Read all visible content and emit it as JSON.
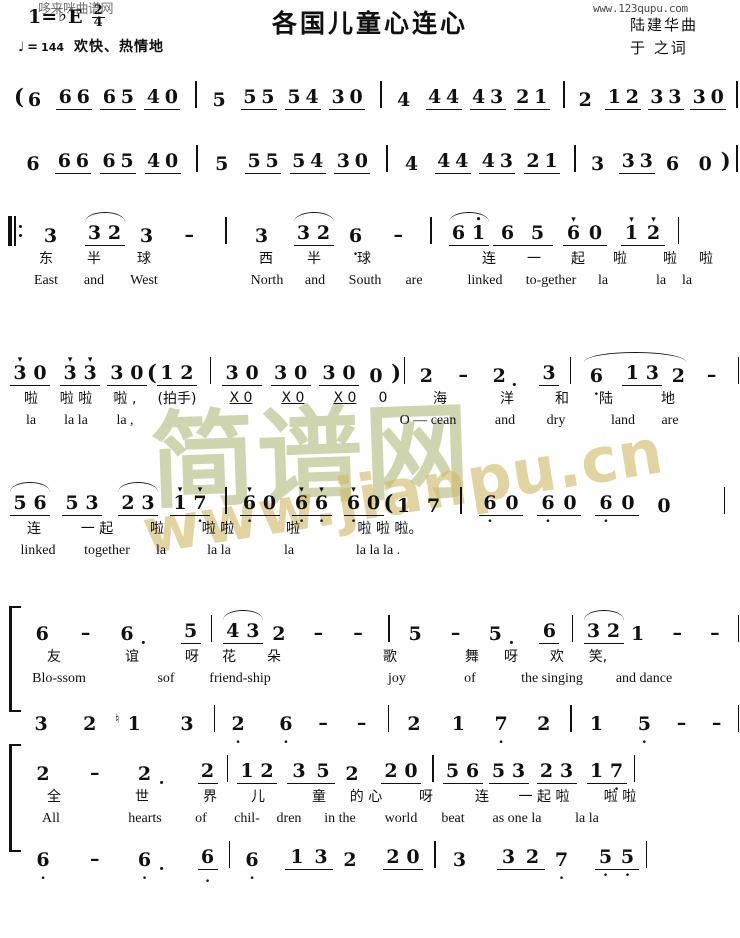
{
  "meta": {
    "title": "各国儿童心连心",
    "composer_credit": "陆建华曲",
    "lyricist_credit": "于 之词",
    "key_label": "1=",
    "key_accidental": "♭",
    "key_letter": "E",
    "time_num": "2",
    "time_den": "4",
    "tempo_note": "♩",
    "tempo_eq": "=",
    "tempo_bpm": "144",
    "expression": "欢快、热情地",
    "watermark_top": "哆来咪曲谱网",
    "watermark_url": "www.123qupu.com",
    "watermark_big": "简谱网",
    "watermark_sub": "www.jianpu.cn"
  },
  "systems": [
    {
      "id": "intro-line-1",
      "notes": [
        "(6",
        "6 6",
        "6 5",
        "4 0",
        "|",
        "5",
        "5 5",
        "5 4",
        "3 0",
        "|",
        "4",
        "4 4",
        "4 3",
        "2 1",
        "|",
        "2",
        "1 2",
        "3 3",
        "3 0",
        "|"
      ]
    },
    {
      "id": "intro-line-2",
      "notes": [
        "6",
        "6 6",
        "6 5",
        "4 0",
        "|",
        "5",
        "5 5",
        "5 4",
        "3 0",
        "|",
        "4",
        "4 4",
        "4 3",
        "2 1",
        "|",
        "3",
        "3 3",
        "6",
        "0",
        ")",
        "|"
      ]
    },
    {
      "id": "verse-line-1",
      "notes": [
        "3",
        "3 2",
        "3",
        "-",
        "|",
        "3",
        "3 2",
        "6̣",
        "-",
        "|",
        "6 1",
        "6",
        "5",
        "6̇ 0",
        "1̇ 2̇",
        "|"
      ],
      "lyrics_cn": [
        "东",
        "半",
        "球",
        "",
        "西",
        "半",
        "球",
        "",
        "连",
        "一",
        "起",
        "啦",
        "啦",
        "啦"
      ],
      "lyrics_en": [
        "East",
        "and",
        "West",
        "",
        "North",
        "and",
        "South",
        "are",
        "linked",
        "to-gether",
        "la",
        "",
        "la",
        "la"
      ]
    },
    {
      "id": "verse-line-2",
      "notes": [
        "3̇ 0",
        "3̇ 3̇",
        "3̇ 0",
        "(1 2",
        "|",
        "3 0",
        "3 0",
        "3 0",
        "0",
        ")",
        "|",
        "2",
        "-",
        "2.",
        "3",
        "|",
        "6̣",
        "1 3",
        "2",
        "-",
        "|"
      ],
      "lyrics_cn": [
        "啦",
        "啦 啦",
        "啦 ,",
        "(拍手)",
        "X 0",
        "X 0",
        "X 0",
        "0",
        "海",
        "洋",
        "和",
        "陆",
        "地"
      ],
      "lyrics_en": [
        "la",
        "la la",
        "la ,",
        "",
        "",
        "",
        "",
        "",
        "O — cean",
        "and",
        "dry",
        "land",
        "are"
      ]
    },
    {
      "id": "verse-line-3",
      "notes": [
        "5 6",
        "5 3",
        "2 3",
        "1 7",
        "|",
        "6̇ 0",
        "6̇ 6̇",
        "6̇ 0",
        "(1 7",
        "|",
        "6̇ 0",
        "6̇ 0",
        "6̇ 0",
        "0",
        "|"
      ],
      "lyrics_cn": [
        "连",
        "一 起",
        "啦",
        "啦 啦",
        "啦",
        "啦 啦 啦。"
      ],
      "lyrics_en": [
        "linked",
        "together",
        "la",
        "la la",
        "la",
        "la la la ."
      ]
    },
    {
      "id": "chorus-line-1",
      "upper": [
        "6",
        "-",
        "6.",
        "5",
        "|",
        "4 3",
        "2",
        "-",
        "-",
        "|",
        "5",
        "-",
        "5.",
        "6",
        "|",
        "3 2",
        "1",
        "-",
        "-",
        "|"
      ],
      "lower": [
        "3",
        "2",
        "♮1",
        "3",
        "|",
        "2̣",
        "6̣",
        "-",
        "-",
        "|",
        "2",
        "1",
        "7̣",
        "2",
        "|",
        "1",
        "5̣",
        "-",
        "-",
        "|"
      ],
      "lyrics_cn": [
        "友",
        "谊",
        "呀",
        "花",
        "朵",
        "歌",
        "舞",
        "呀",
        "欢",
        "笑,"
      ],
      "lyrics_en": [
        "Blo-ssom",
        "sof",
        "friend-ship",
        "joy",
        "of",
        "the singing",
        "and dance"
      ]
    },
    {
      "id": "chorus-line-2",
      "upper": [
        "2",
        "-",
        "2.",
        "2",
        "|",
        "1 2",
        "3 5",
        "2",
        "2 0",
        "|",
        "5 6",
        "5 3",
        "2 3",
        "1 7",
        "|"
      ],
      "lower": [
        "6̣",
        "-",
        "6̣.",
        "6̣",
        "|",
        "6̣",
        "1 3",
        "2",
        "2 0",
        "|",
        "3",
        "3 2",
        "7̣",
        "5̣ 5̣",
        "|"
      ],
      "lyrics_cn": [
        "全",
        "世",
        "界",
        "儿",
        "童",
        "的 心",
        "呀",
        "连",
        "一 起 啦",
        "啦 啦"
      ],
      "lyrics_en": [
        "All",
        "hearts",
        "of",
        "chil-",
        "dren",
        "in the",
        "world",
        "beat",
        "as one la",
        "la la"
      ]
    }
  ]
}
